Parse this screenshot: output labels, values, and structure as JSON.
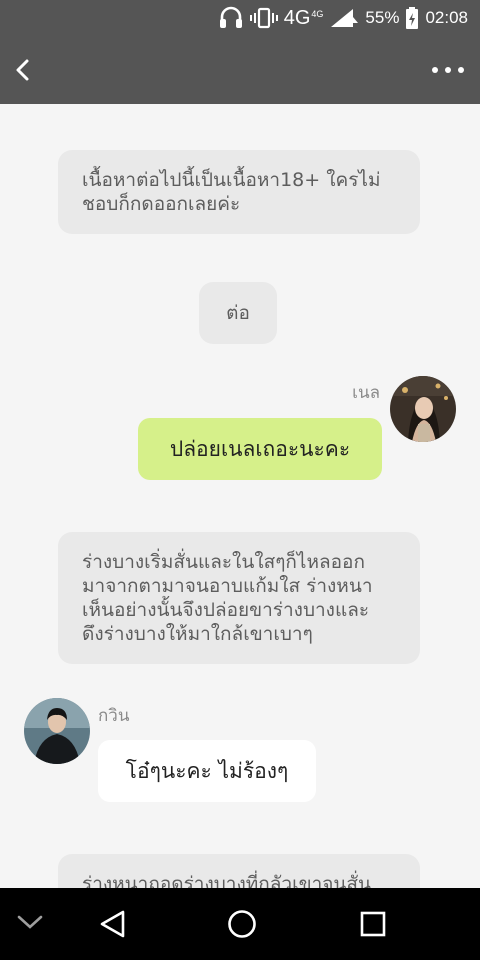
{
  "status_bar": {
    "network": "4G",
    "network_small": "4G",
    "battery": "55%",
    "time": "02:08",
    "icons": [
      "headphones-icon",
      "vibrate-icon",
      "signal-icon",
      "battery-icon"
    ]
  },
  "header": {
    "back_icon": "chevron-left-icon",
    "more_icon": "more-dots-icon"
  },
  "messages": {
    "narration_1": "เนื้อหาต่อไปนี้เป็นเนื้อหา18+ ใครไม่\nชอบก็กดออกเลยค่ะ",
    "narration_2": "ต่อ",
    "right_name": "เนล",
    "right_text": "ปล่อยเนลเถอะนะคะ",
    "narration_3": "ร่างบางเริ่มสั่นและในใสๆก็ไหลออก\nมาจากตามาจนอาบแก้มใส ร่างหนา\nเห็นอย่างนั้นจึงปล่อยขาร่างบางและ\nดึงร่างบางให้มาใกล้เขาเบาๆ",
    "left_name": "กวิน",
    "left_text": "โอ๋ๆนะคะ ไม่ร้องๆ",
    "narration_4": "ร่างหนาถอดร่างบางที่กลัวเขาจนสั่น"
  },
  "nav_bar": {
    "icons": [
      "collapse-icon",
      "back-triangle-icon",
      "home-circle-icon",
      "recents-square-icon"
    ]
  },
  "colors": {
    "bar": "#555555",
    "background": "#f5f5f5",
    "narration_bg": "#e9e9e9",
    "right_bubble": "#d6f08a",
    "left_bubble": "#ffffff"
  }
}
